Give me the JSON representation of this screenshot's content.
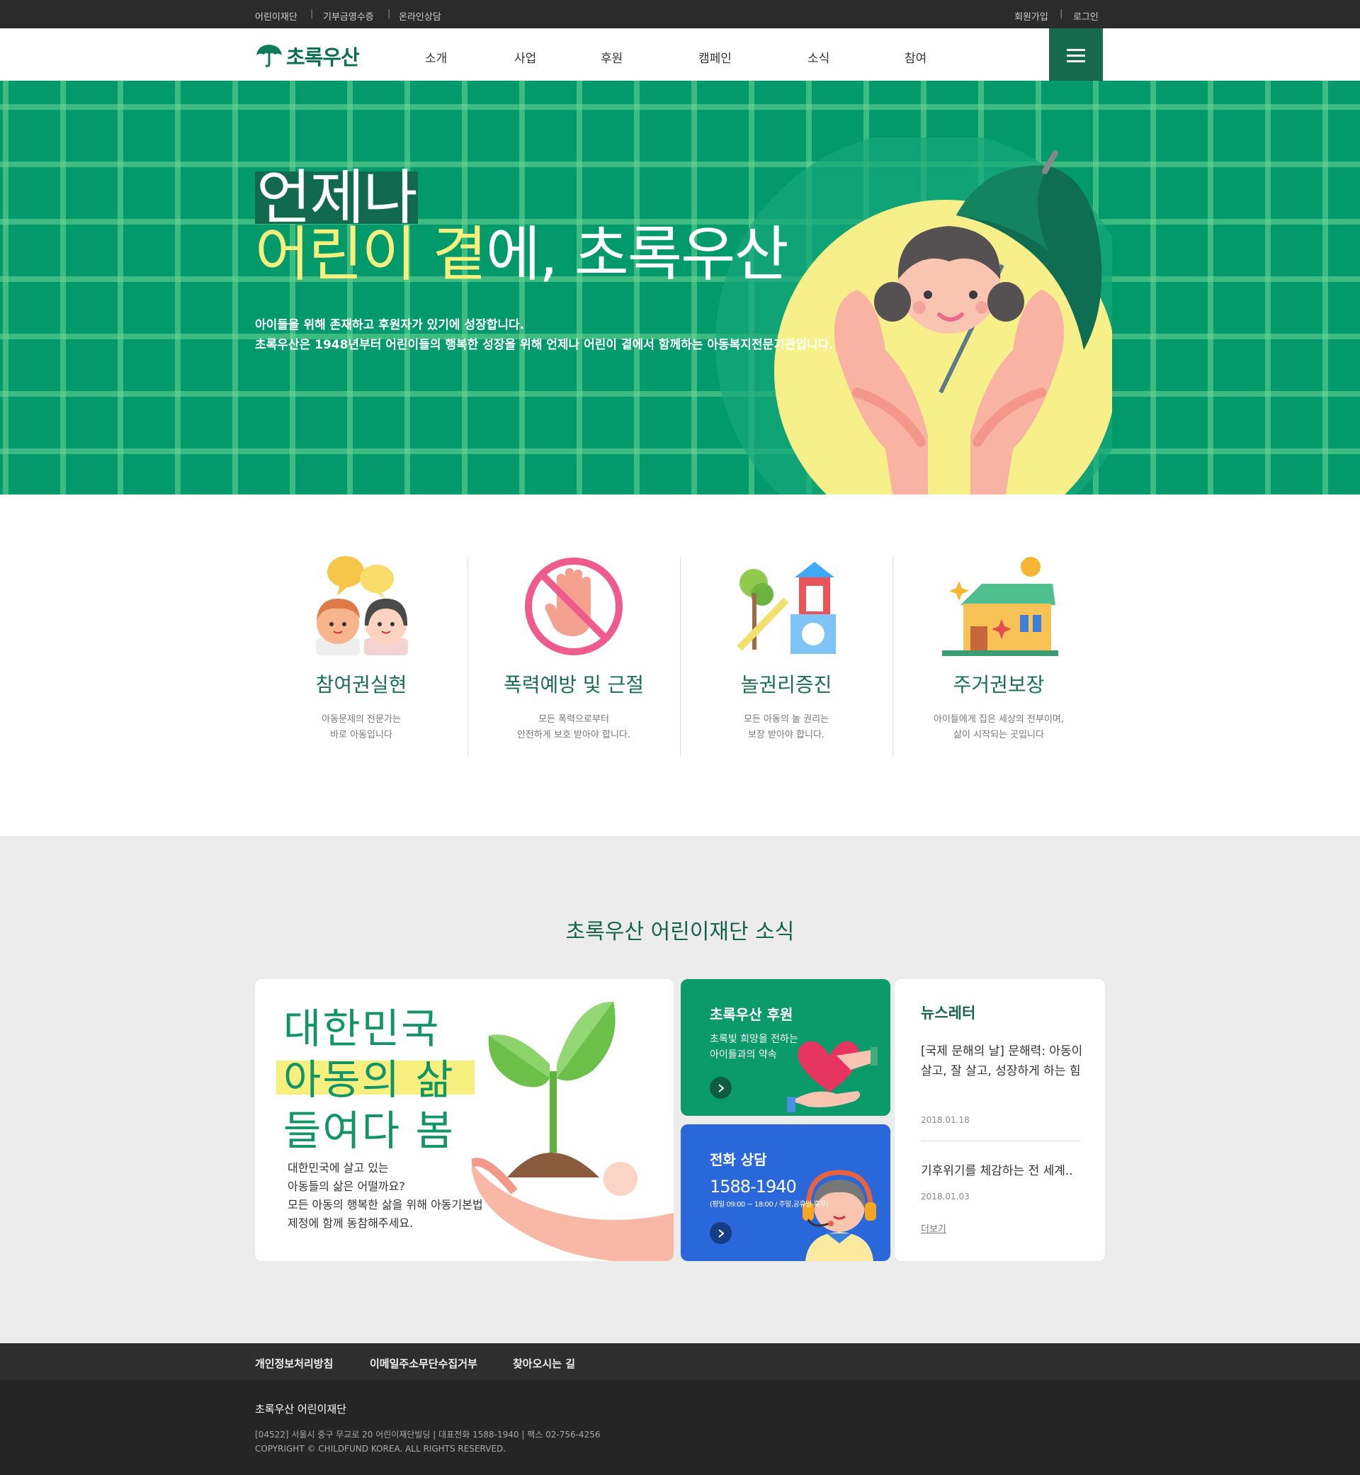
{
  "topbar": {
    "left_links": [
      "어린이재단",
      "기부금영수증",
      "온라인상담"
    ],
    "right_links": [
      "회원가입",
      "로그인"
    ],
    "separator": "|"
  },
  "header": {
    "logo_text": "초록우산",
    "nav": [
      "소개",
      "사업",
      "후원",
      "캠페인",
      "소식",
      "참여"
    ]
  },
  "hero": {
    "line1": "언제나",
    "line2_a": "어린이",
    "line2_b": "곁",
    "line2_c": "에, 초록우산",
    "desc1": "아이들을 위해 존재하고 후원자가 있기에 성장합니다.",
    "desc2": "초록우산은 1948년부터 어린이들의 행복한 성장을 위해 언제나 어린이 곁에서 함께하는 아동복지전문기관입니다."
  },
  "features": [
    {
      "title": "참여권실현",
      "desc1": "아동문제의 전문가는",
      "desc2": "바로 아동입니다",
      "icon": "talking-children-icon"
    },
    {
      "title": "폭력예방 및 근절",
      "desc1": "모든 폭력으로부터",
      "desc2": "안전하게 보호 받아야 합니다.",
      "icon": "stop-hand-icon"
    },
    {
      "title": "놀권리증진",
      "desc1": "모든 아동의 놀 권리는",
      "desc2": "보장 받아야 합니다.",
      "icon": "playground-icon"
    },
    {
      "title": "주거권보장",
      "desc1": "아이들에게 집은 세상의 전부이며,",
      "desc2": "삶이 시작되는 곳입니다",
      "icon": "house-icon"
    }
  ],
  "news": {
    "section_title": "초록우산 어린이재단 소식",
    "main_card": {
      "h1": "대한민국",
      "h2": "아동의 삶",
      "h3": "들여다 봄",
      "p1": "대한민국에 살고 있는",
      "p2": "아동들의 삶은 어떨까요?",
      "p3": "모든 아동의 행복한 삶을 위해 아동기본법",
      "p4": "제정에 함께 동참해주세요."
    },
    "sponsor_card": {
      "title": "초록우산 후원",
      "desc1": "초록빛 희망을 전하는",
      "desc2": "아이들과의 약속"
    },
    "phone_card": {
      "title": "전화 상담",
      "number": "1588-1940",
      "hours": "(평일 09:00 ~ 18:00 / 주말,공휴일 휴무)"
    },
    "newsletter": {
      "title": "뉴스레터",
      "item1_title_1": "[국제 문해의 날] 문해력: 아동이",
      "item1_title_2": "살고, 잘 살고, 성장하게 하는 힘",
      "item1_date": "2018.01.18",
      "item2_title": "기후위기를 체감하는 전 세계..",
      "item2_date": "2018.01.03",
      "more": "더보기"
    }
  },
  "footer": {
    "links": [
      "개인정보처리방침",
      "이메일주소무단수집거부",
      "찾아오시는 길"
    ],
    "org": "초록우산 어린이재단",
    "address": "[04522] 서울시 중구 무교로 20 어린이재단빌딩 | 대표전화 1588-1940 | 팩스 02-756-4256",
    "copyright": "COPYRIGHT © CHILDFUND KOREA. ALL RIGHTS RESERVED."
  },
  "colors": {
    "brand_green": "#039a6b",
    "dark_green": "#17694d",
    "highlight_yellow": "#f7ef7e",
    "phone_blue": "#2a67db",
    "footer_dark": "#252525"
  }
}
